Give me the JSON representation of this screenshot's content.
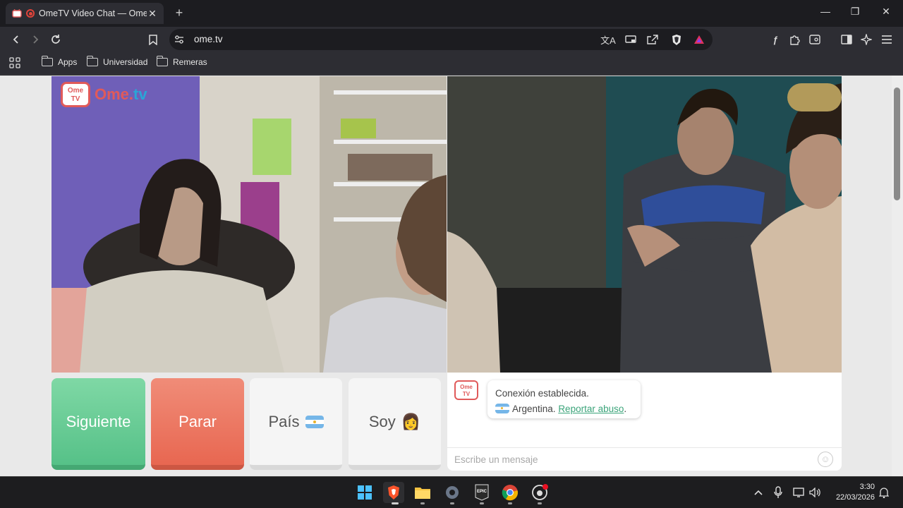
{
  "browser": {
    "tab": {
      "title": "OmeTV Video Chat — Omegl",
      "close_glyph": "✕"
    },
    "new_tab_glyph": "+",
    "window_controls": {
      "minimize": "—",
      "restore": "❐",
      "close": "✕"
    },
    "url": "ome.tv",
    "bookmarks": [
      {
        "label": "Apps"
      },
      {
        "label": "Universidad"
      },
      {
        "label": "Remeras"
      }
    ]
  },
  "site": {
    "logo": {
      "badge_line1": "Ome",
      "badge_line2": "TV",
      "wordmark_ome": "Ome.",
      "wordmark_tv": "tv"
    },
    "buttons": {
      "next": "Siguiente",
      "stop": "Parar",
      "country": "País",
      "me": "Soy",
      "me_emoji": "👩"
    },
    "chat": {
      "logo_line1": "Ome",
      "logo_line2": "TV",
      "status": "Conexión establecida.",
      "country": "Argentina.",
      "report_link": "Reportar abuso",
      "report_suffix": ".",
      "input_placeholder": "Escribe un mensaje"
    }
  },
  "taskbar": {
    "time": "3:30",
    "date": "22/03/2026",
    "apps": [
      "windows-start",
      "brave",
      "file-explorer",
      "settings",
      "epic-games",
      "chrome",
      "github-desktop"
    ]
  },
  "colors": {
    "next_button": "#5cc58e",
    "stop_button": "#ea6d57",
    "link_green": "#3ba47a",
    "brand_red": "#e05a5a",
    "brand_blue": "#2aa5d6"
  }
}
